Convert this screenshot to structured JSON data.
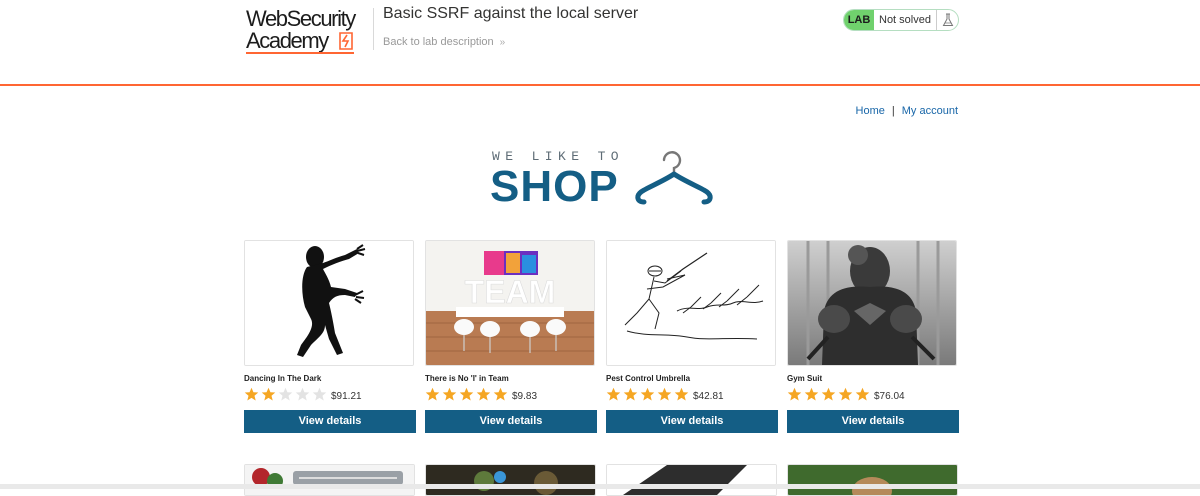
{
  "academy": {
    "logo": {
      "line1": "WebSecurity",
      "line2": "Academy"
    },
    "lab_title": "Basic SSRF against the local server",
    "back_link": "Back to lab description",
    "status": {
      "badge": "LAB",
      "text": "Not solved"
    }
  },
  "shop_nav": {
    "home": "Home",
    "separator": "|",
    "account": "My account"
  },
  "banner": {
    "small": "WE LIKE TO",
    "big": "SHOP"
  },
  "products": [
    {
      "name": "Dancing In The Dark",
      "rating": 2,
      "price": "$91.21",
      "button": "View details"
    },
    {
      "name": "There is No 'I' in Team",
      "rating": 5,
      "price": "$9.83",
      "button": "View details"
    },
    {
      "name": "Pest Control Umbrella",
      "rating": 5,
      "price": "$42.81",
      "button": "View details"
    },
    {
      "name": "Gym Suit",
      "rating": 5,
      "price": "$76.04",
      "button": "View details"
    }
  ],
  "colors": {
    "accent": "#ff6633",
    "primary": "#145e85",
    "link": "#1866a8",
    "star": "#f5a623",
    "star_empty": "#e3e3e3",
    "lab_green": "#70d16d"
  }
}
